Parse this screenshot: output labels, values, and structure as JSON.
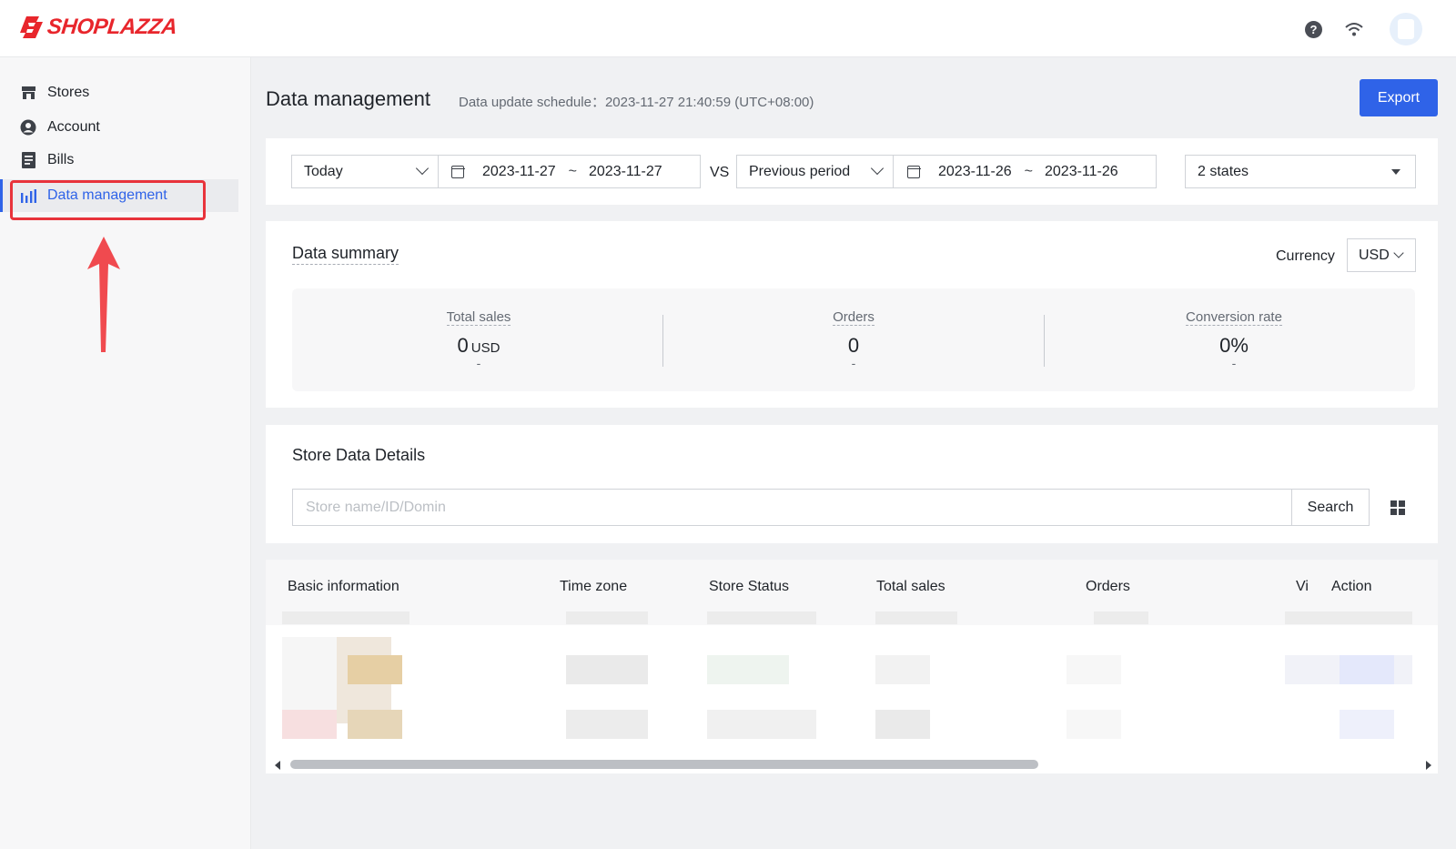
{
  "brand": {
    "name": "SHOPLAZZA",
    "color": "#e8262c"
  },
  "header": {
    "help_icon": "question-circle-icon",
    "network_icon": "wifi-icon",
    "avatar_icon": "avatar"
  },
  "sidebar": {
    "items": [
      {
        "label": "Stores",
        "icon": "store-icon"
      },
      {
        "label": "Account",
        "icon": "user-circle-icon"
      },
      {
        "label": "Bills",
        "icon": "document-icon"
      },
      {
        "label": "Data management",
        "icon": "bar-chart-icon",
        "active": true
      }
    ]
  },
  "page": {
    "title": "Data management",
    "update_schedule": "Data update schedule：2023-11-27 21:40:59 (UTC+08:00)",
    "export_label": "Export"
  },
  "filters": {
    "period": "Today",
    "date_start": "2023-11-27",
    "date_end": "2023-11-27",
    "separator": "~",
    "vs": "VS",
    "compare_period": "Previous period",
    "compare_start": "2023-11-26",
    "compare_end": "2023-11-26",
    "states": "2 states"
  },
  "summary": {
    "title": "Data summary",
    "currency_label": "Currency",
    "currency": "USD",
    "stats": [
      {
        "label": "Total sales",
        "value": "0",
        "unit": "USD",
        "delta": "-"
      },
      {
        "label": "Orders",
        "value": "0",
        "unit": "",
        "delta": "-"
      },
      {
        "label": "Conversion rate",
        "value": "0%",
        "unit": "",
        "delta": "-"
      }
    ]
  },
  "details": {
    "title": "Store Data Details",
    "search_placeholder": "Store name/ID/Domin",
    "search_label": "Search",
    "columns": [
      "Basic information",
      "Time zone",
      "Store Status",
      "Total sales",
      "Orders",
      "Vi",
      "Action"
    ]
  },
  "colors": {
    "accent": "#2f63e8",
    "highlight": "#e8333b"
  }
}
